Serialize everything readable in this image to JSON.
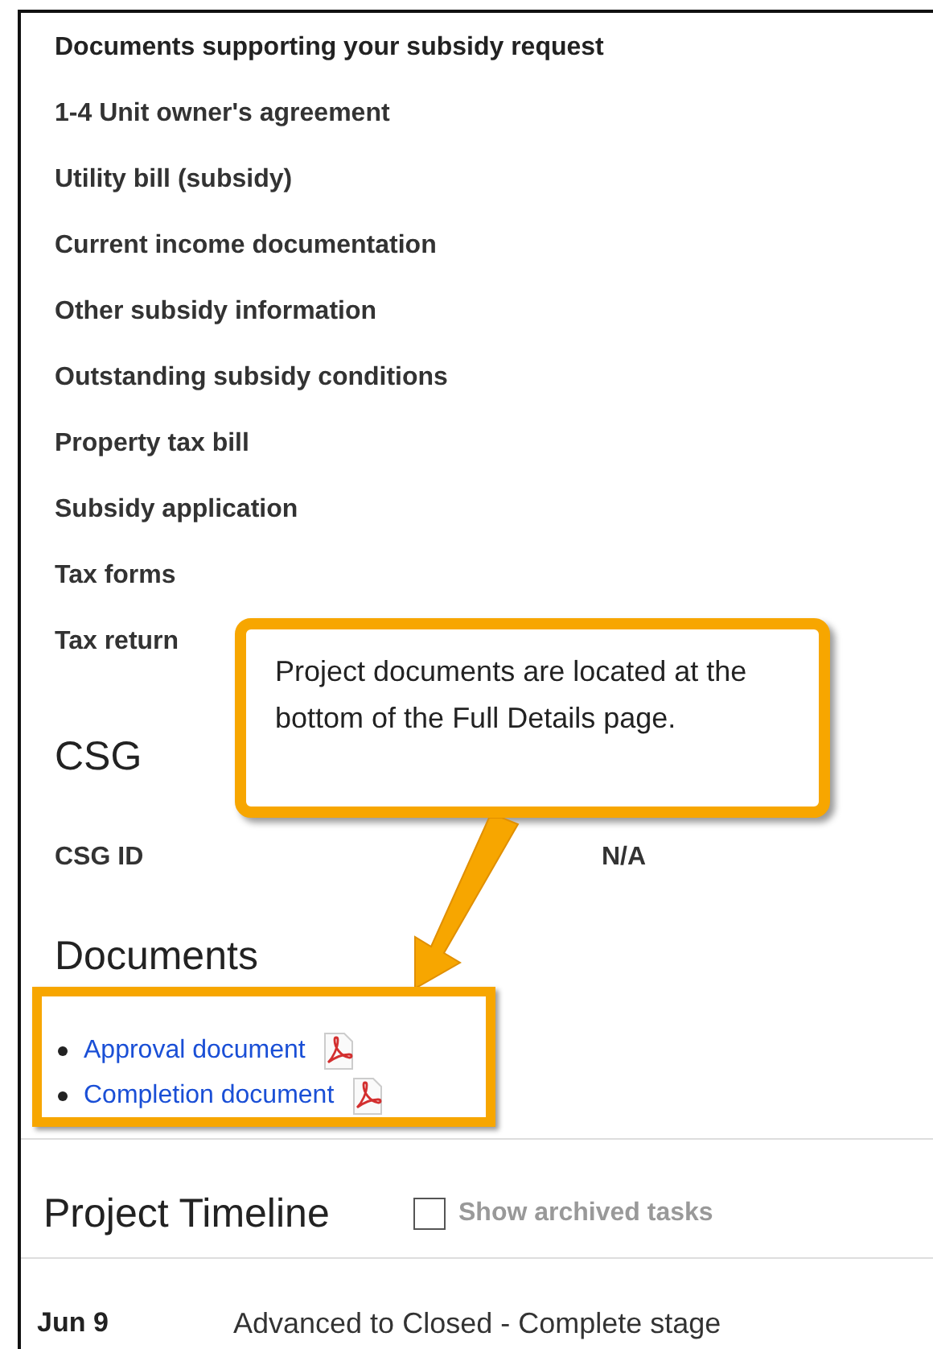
{
  "subsidy_documents": {
    "heading": "Documents supporting your subsidy request",
    "items": [
      "1-4 Unit owner's agreement",
      "Utility bill (subsidy)",
      "Current income documentation",
      "Other subsidy information",
      "Outstanding subsidy conditions",
      "Property tax bill",
      "Subsidy application",
      "Tax forms",
      "Tax return"
    ]
  },
  "csg": {
    "heading": "CSG",
    "fields": [
      {
        "label": "CSG ID",
        "value": "N/A"
      }
    ]
  },
  "documents": {
    "heading": "Documents",
    "links": [
      {
        "label": "Approval document"
      },
      {
        "label": "Completion document"
      }
    ]
  },
  "callout": {
    "text": "Project documents are located at the bottom of the Full Details page."
  },
  "timeline": {
    "heading": "Project Timeline",
    "show_archived": {
      "label": "Show archived tasks",
      "checked": false
    },
    "entries": [
      {
        "date": "Jun 9",
        "event": "Advanced to Closed - Complete stage"
      }
    ]
  }
}
